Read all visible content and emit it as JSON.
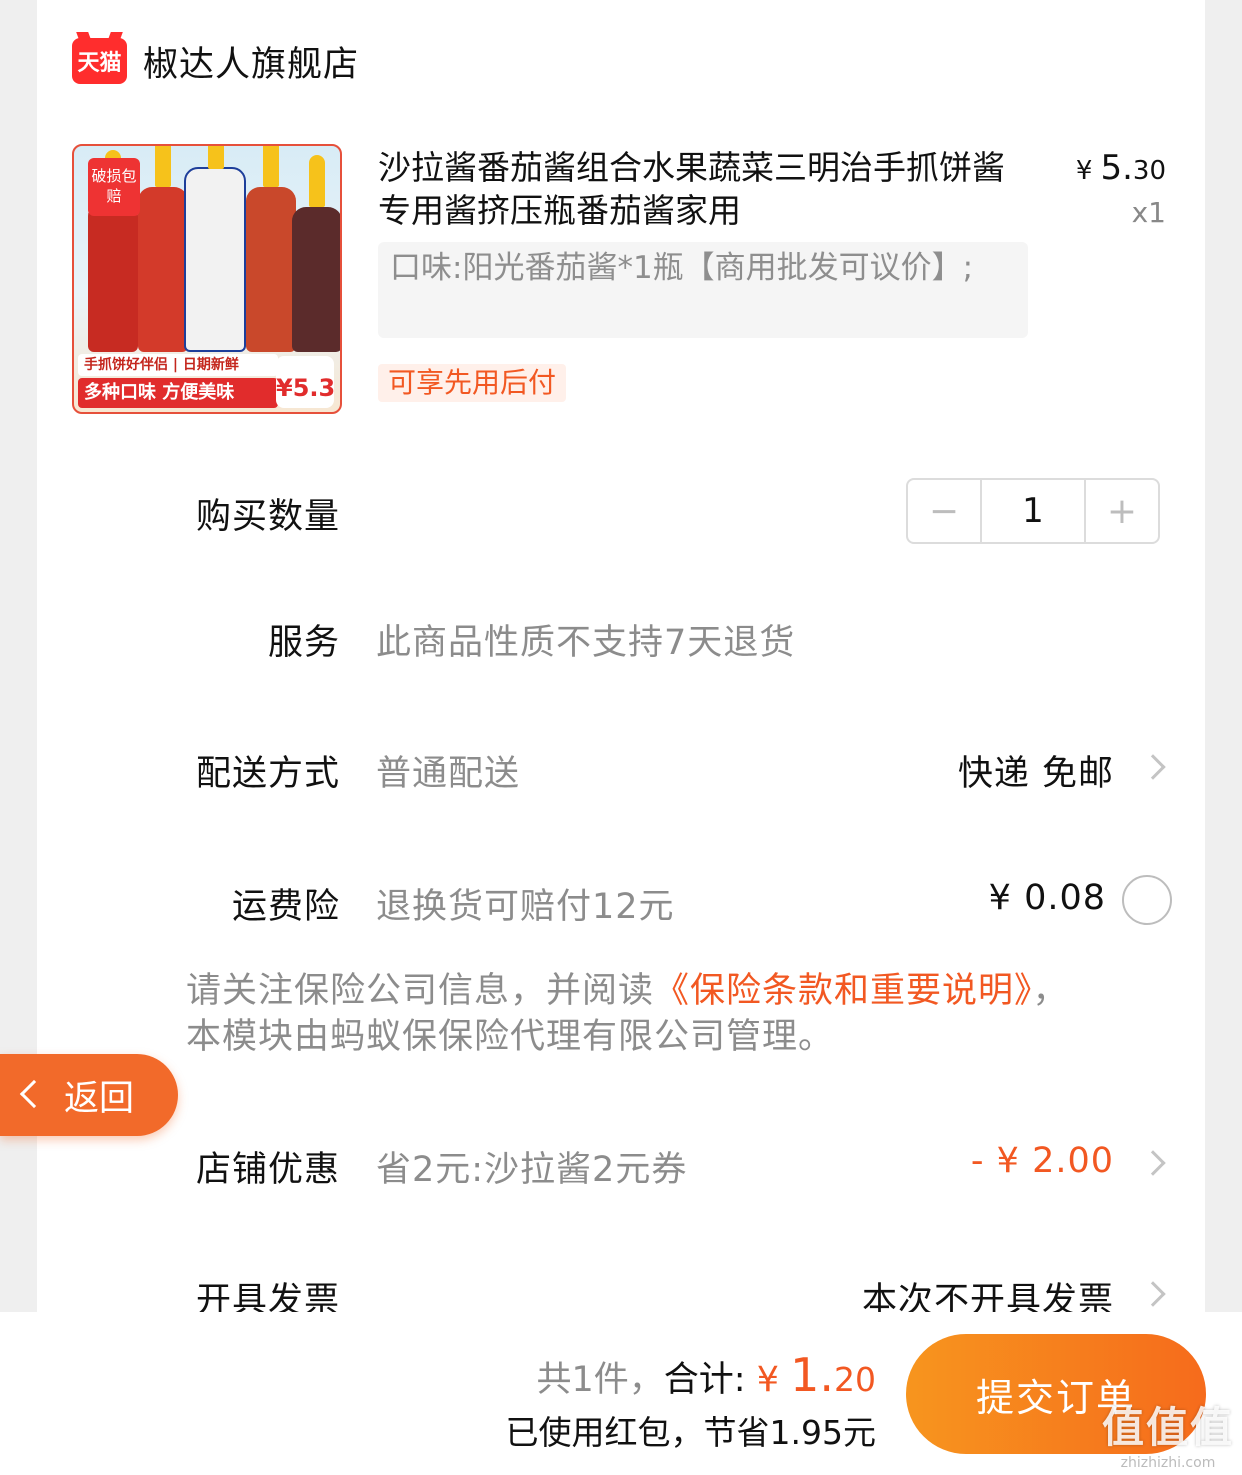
{
  "shop": {
    "logo_text": "天猫",
    "name": "椒达人旗舰店"
  },
  "product": {
    "image_badge": "破损包赔",
    "image_banner1": "手抓饼好伴侣 | 日期新鲜",
    "image_banner2": "多种口味 方便美味",
    "image_price": "¥5.3",
    "title": "沙拉酱番茄酱组合水果蔬菜三明治手抓饼酱专用酱挤压瓶番茄酱家用",
    "price_symbol": "¥",
    "price_int": "5.",
    "price_dec": "30",
    "quantity_label": "x1",
    "sku": "口味:阳光番茄酱*1瓶【商用批发可议价】;",
    "tag": "可享先用后付"
  },
  "rows": {
    "quantity": {
      "label": "购买数量",
      "minus": "−",
      "value": "1",
      "plus": "+"
    },
    "service": {
      "label": "服务",
      "desc": "此商品性质不支持7天退货"
    },
    "delivery": {
      "label": "配送方式",
      "desc": "普通配送",
      "value": "快递 免邮"
    },
    "shipping_insurance": {
      "label": "运费险",
      "desc": "退换货可赔付12元",
      "value": "¥ 0.08"
    },
    "shop_discount": {
      "label": "店铺优惠",
      "desc": "省2元:沙拉酱2元券",
      "value": "- ¥ 2.00"
    },
    "invoice": {
      "label": "开具发票",
      "value": "本次不开具发票"
    }
  },
  "notice": {
    "prefix": "请关注保险公司信息，并阅读",
    "link": "《保险条款和重要说明》",
    "suffix": "，本模块由蚂蚁保保险代理有限公司管理。"
  },
  "back_button": {
    "label": "返回"
  },
  "footer": {
    "count_text": "共1件，",
    "total_label": "合计: ",
    "total_symbol": "¥ ",
    "total_int": "1.",
    "total_dec": "20",
    "saved_text": "已使用红包，节省1.95元",
    "submit_label": "提交订单"
  },
  "watermark": {
    "title": "值值值",
    "url": "zhizhizhi.com"
  },
  "colors": {
    "accent": "#f25822",
    "tmall_red": "#ff2d2d",
    "submit_start": "#f7951e",
    "submit_end": "#f66b1c"
  }
}
